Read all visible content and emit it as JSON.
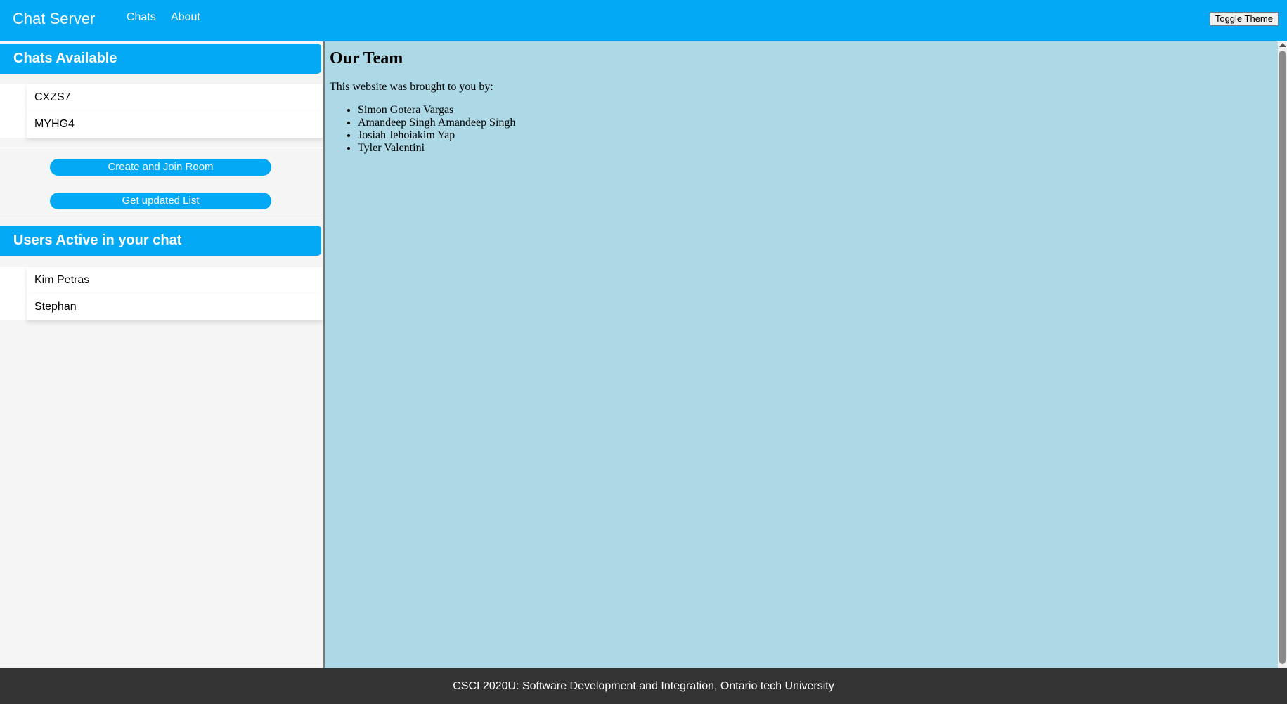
{
  "header": {
    "brand": "Chat Server",
    "nav": [
      "Chats",
      "About"
    ],
    "toggle_theme_label": "Toggle Theme"
  },
  "sidebar": {
    "chats_header": "Chats Available",
    "chats": [
      "CXZS7",
      "MYHG4"
    ],
    "create_join_label": "Create and Join Room",
    "update_list_label": "Get updated List",
    "users_header": "Users Active in your chat",
    "users": [
      "Kim Petras",
      "Stephan"
    ]
  },
  "main": {
    "title": "Our Team",
    "intro": "This website was brought to you by:",
    "team": [
      "Simon Gotera Vargas",
      "Amandeep Singh Amandeep Singh",
      "Josiah Jehoiakim Yap",
      "Tyler Valentini"
    ]
  },
  "footer": {
    "text": "CSCI 2020U: Software Development and Integration, Ontario tech University"
  },
  "colors": {
    "accent": "#03a9f4",
    "main_bg": "#add8e6",
    "sidebar_bg": "#f5f5f5",
    "footer_bg": "#333333"
  }
}
